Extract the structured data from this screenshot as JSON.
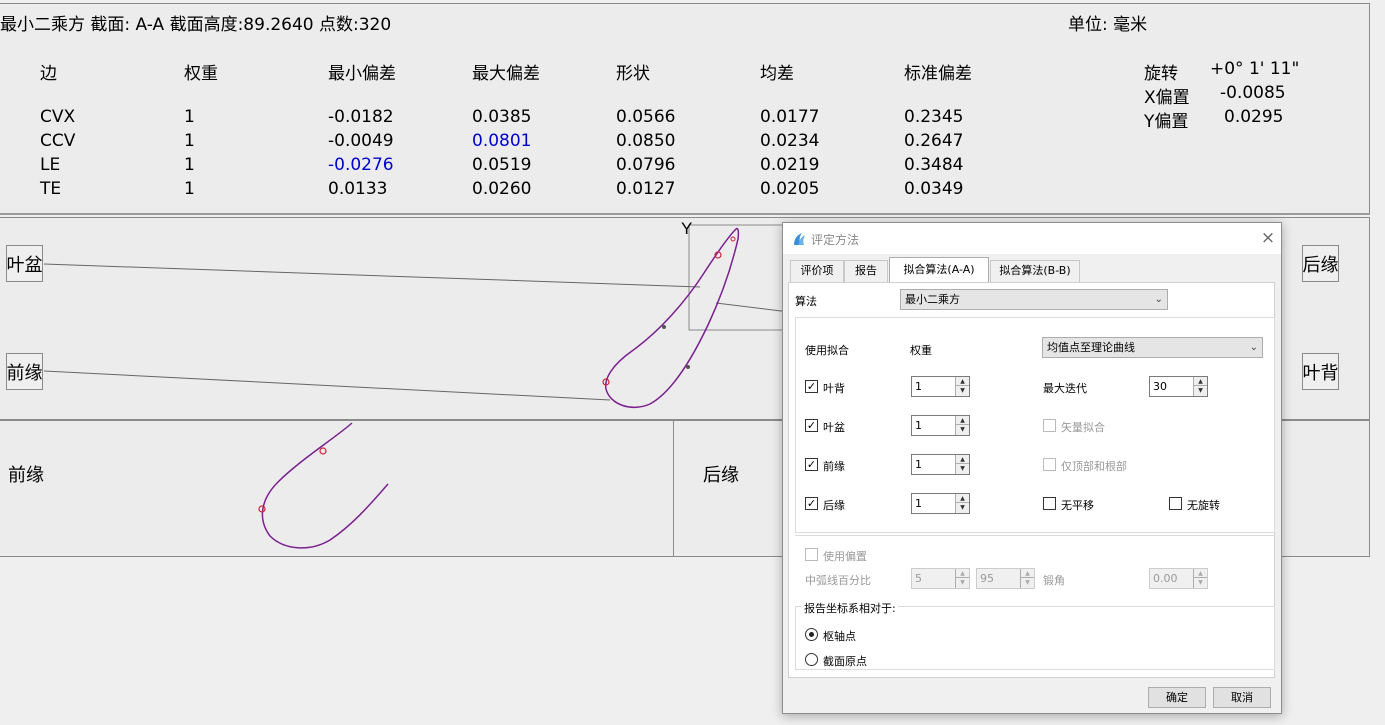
{
  "report": {
    "title": "最小二乘方 截面: A-A 截面高度:89.2640 点数:320",
    "unit": "单位: 毫米",
    "headers": [
      "边",
      "权重",
      "最小偏差",
      "最大偏差",
      "形状",
      "均差",
      "标准偏差"
    ],
    "rows": [
      [
        "CVX",
        "1",
        "-0.0182",
        "0.0385",
        "0.0566",
        "0.0177",
        "0.2345"
      ],
      [
        "CCV",
        "1",
        "-0.0049",
        "0.0801",
        "0.0850",
        "0.0234",
        "0.2647"
      ],
      [
        "LE",
        "1",
        "-0.0276",
        "0.0519",
        "0.0796",
        "0.0219",
        "0.3484"
      ],
      [
        "TE",
        "1",
        "0.0133",
        "0.0260",
        "0.0127",
        "0.0205",
        "0.0349"
      ]
    ],
    "rotation_label": "旋转",
    "rotation_value": "+0° 1' 11\"",
    "x_offset_label": "X偏置",
    "x_offset_value": "-0.0085",
    "y_offset_label": "Y偏置",
    "y_offset_value": "0.0295",
    "highlight_color": "#0000cc"
  },
  "graph": {
    "axis_label": "Y",
    "buttons": {
      "pressure": "叶盆",
      "leading": "前缘",
      "trailing": "后缘",
      "suction": "叶背"
    },
    "curve_color": "#7a1f8f",
    "marker_color": "#d0203a"
  },
  "bottom": {
    "left_label": "前缘",
    "right_label": "后缘"
  },
  "dialog": {
    "title": "评定方法",
    "close": "×",
    "tabs": [
      "评价项",
      "报告",
      "拟合算法(A-A)",
      "拟合算法(B-B)"
    ],
    "active_tab": 2,
    "algorithm_label": "算法",
    "algorithm_value": "最小二乘方",
    "use_fit_label": "使用拟合",
    "weight_label": "权重",
    "method_value": "均值点至理论曲线",
    "fit_rows": [
      {
        "label": "叶背",
        "checked": true,
        "weight": "1"
      },
      {
        "label": "叶盆",
        "checked": true,
        "weight": "1"
      },
      {
        "label": "前缘",
        "checked": true,
        "weight": "1"
      },
      {
        "label": "后缘",
        "checked": true,
        "weight": "1"
      }
    ],
    "max_iter_label": "最大迭代",
    "max_iter_value": "30",
    "vector_fit_label": "矢量拟合",
    "tip_root_label": "仅顶部和根部",
    "no_translate_label": "无平移",
    "no_rotate_label": "无旋转",
    "use_offset_label": "使用偏置",
    "camber_pct_label": "中弧线百分比",
    "camber_from": "5",
    "camber_to": "95",
    "twist_label": "锻角",
    "twist_value": "0.00",
    "coord_group_label": "报告坐标系相对于:",
    "radio_pivot_label": "枢轴点",
    "radio_origin_label": "截面原点",
    "radio_selected": "pivot",
    "ok_label": "确定",
    "cancel_label": "取消"
  }
}
